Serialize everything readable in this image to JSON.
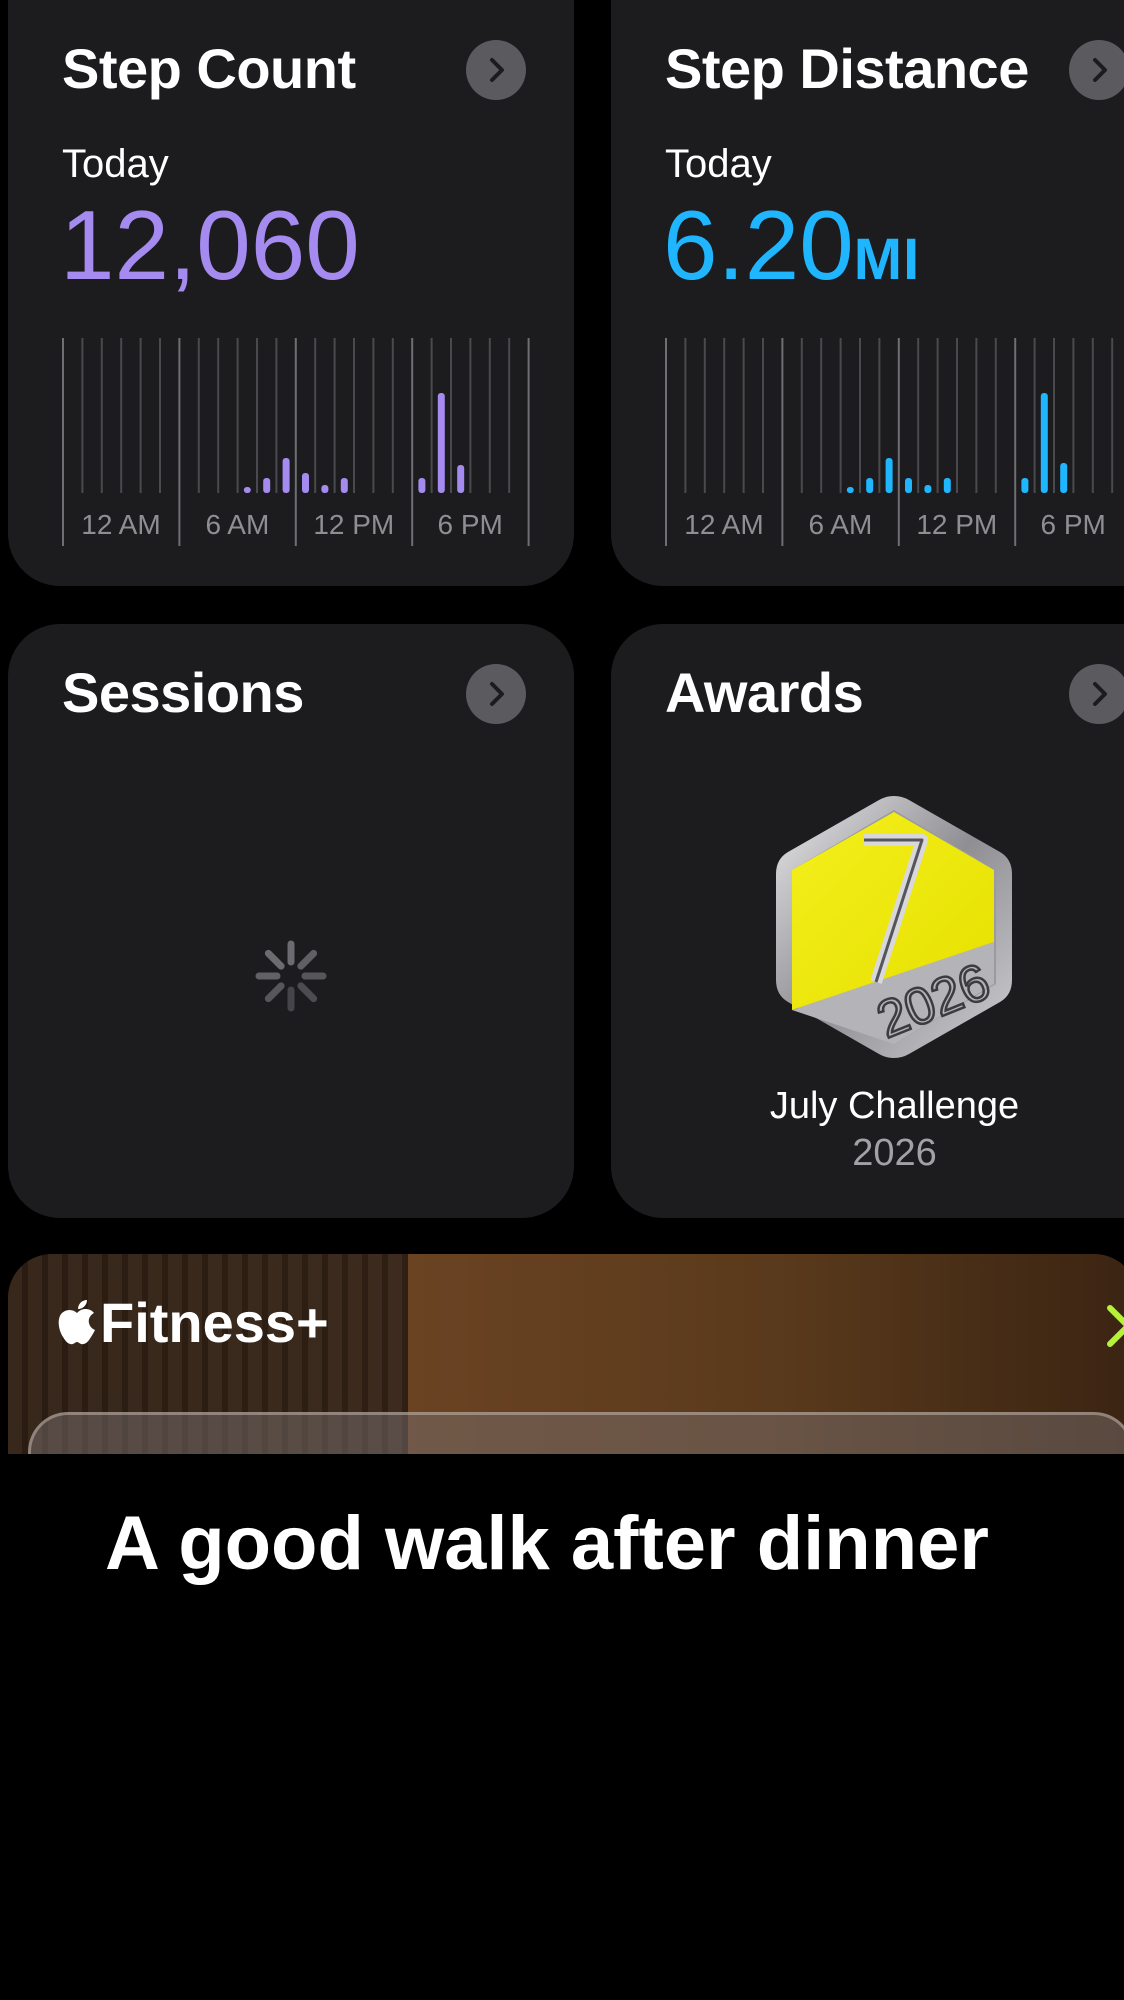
{
  "step_count": {
    "title": "Step Count",
    "period": "Today",
    "value": "12,060",
    "color": "#a58aef"
  },
  "step_distance": {
    "title": "Step Distance",
    "period": "Today",
    "value": "6.20",
    "unit": "MI",
    "color": "#1fb6ff"
  },
  "sessions": {
    "title": "Sessions"
  },
  "awards": {
    "title": "Awards",
    "award_name": "July Challenge",
    "award_year": "2026",
    "badge_number": "7",
    "badge_year_text": "2026"
  },
  "fitness_plus": {
    "label": "Fitness+",
    "accent": "#b6f23a",
    "tagline": "A good walk after dinner"
  },
  "chart_data": [
    {
      "type": "bar",
      "categories": [
        "12 AM",
        "1",
        "2",
        "3",
        "4",
        "5",
        "6 AM",
        "7",
        "8",
        "9",
        "10",
        "11",
        "12 PM",
        "1",
        "2",
        "3",
        "4",
        "5",
        "6 PM",
        "7",
        "8",
        "9",
        "10",
        "11"
      ],
      "values": [
        0,
        0,
        0,
        0,
        0,
        0,
        0,
        0,
        0,
        0.05,
        0.15,
        0.35,
        0.2,
        0.08,
        0.15,
        0,
        0,
        0,
        0.15,
        1.0,
        0.28,
        0,
        0,
        0
      ],
      "tick_labels": [
        "12 AM",
        "6 AM",
        "12 PM",
        "6 PM"
      ]
    },
    {
      "type": "bar",
      "categories": [
        "12 AM",
        "1",
        "2",
        "3",
        "4",
        "5",
        "6 AM",
        "7",
        "8",
        "9",
        "10",
        "11",
        "12 PM",
        "1",
        "2",
        "3",
        "4",
        "5",
        "6 PM",
        "7",
        "8",
        "9",
        "10",
        "11"
      ],
      "values": [
        0,
        0,
        0,
        0,
        0,
        0,
        0,
        0,
        0,
        0.05,
        0.15,
        0.35,
        0.15,
        0.08,
        0.15,
        0,
        0,
        0,
        0.15,
        1.0,
        0.3,
        0,
        0,
        0
      ],
      "tick_labels": [
        "12 AM",
        "6 AM",
        "12 PM",
        "6 PM"
      ]
    }
  ]
}
